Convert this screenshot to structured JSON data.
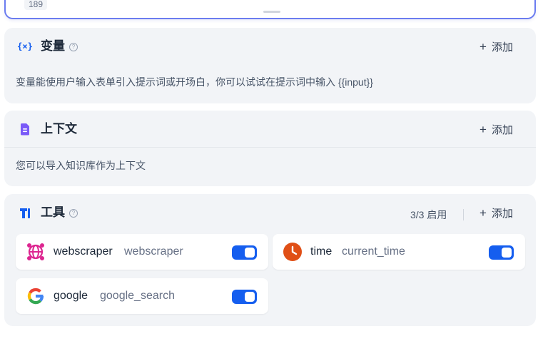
{
  "prompt": {
    "char_count": "189"
  },
  "variables": {
    "title": "变量",
    "add_label": "添加",
    "description": "变量能使用户输入表单引入提示词或开场白，你可以试试在提示词中输入 {{input}}"
  },
  "context": {
    "title": "上下文",
    "add_label": "添加",
    "description": "您可以导入知识库作为上下文"
  },
  "tools": {
    "title": "工具",
    "status": "3/3 启用",
    "add_label": "添加",
    "items": [
      {
        "name": "webscraper",
        "id": "webscraper",
        "enabled": true
      },
      {
        "name": "time",
        "id": "current_time",
        "enabled": true
      },
      {
        "name": "google",
        "id": "google_search",
        "enabled": true
      }
    ]
  },
  "colors": {
    "accent": "#155eef",
    "panel_bg": "#f2f4f7"
  }
}
